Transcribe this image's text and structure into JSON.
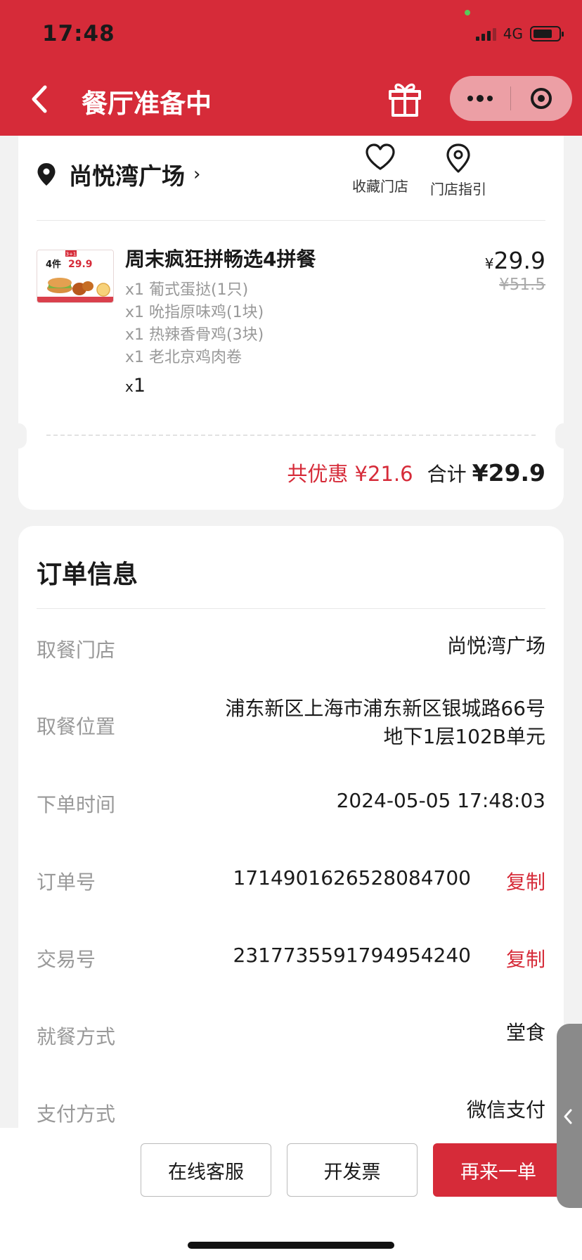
{
  "status_bar": {
    "time": "17:48",
    "network": "4G",
    "battery_level": 0.75,
    "signal_icon": "signal-bars-icon"
  },
  "nav": {
    "title": "餐厅准备中",
    "back_icon": "chevron-left-icon",
    "gift_icon": "gift-icon",
    "more_icon": "more-dots-icon",
    "close_icon": "target-close-icon",
    "brand_color": "#d62b39"
  },
  "store": {
    "name": "尚悦湾广场",
    "favorite_label": "收藏门店",
    "directions_label": "门店指引"
  },
  "product": {
    "title": "周末疯狂拼畅选4拼餐",
    "items": [
      "x1 葡式蛋挞(1只)",
      "x1 吮指原味鸡(1块)",
      "x1 热辣香骨鸡(3块)",
      "x1 老北京鸡肉卷"
    ],
    "qty_prefix": "x",
    "qty": "1",
    "price_symbol": "¥",
    "price": "29.9",
    "original_price": "¥51.5",
    "image": {
      "badge": "4件",
      "price": "29.9",
      "tag": "3+1"
    }
  },
  "totals": {
    "discount": "共优惠 ¥21.6",
    "label": "合计",
    "value": "¥29.9"
  },
  "order_info": {
    "heading": "订单信息",
    "rows": [
      {
        "label": "取餐门店",
        "value": "尚悦湾广场"
      },
      {
        "label": "取餐位置",
        "value_line1": "浦东新区上海市浦东新区银城路66号",
        "value_line2": "地下1层102B单元"
      },
      {
        "label": "下单时间",
        "value": "2024-05-05 17:48:03"
      },
      {
        "label": "订单号",
        "value": "1714901626528084700",
        "action": "复制"
      },
      {
        "label": "交易号",
        "value": "2317735591794954240",
        "action": "复制"
      },
      {
        "label": "就餐方式",
        "value": "堂食"
      },
      {
        "label": "支付方式",
        "value": "微信支付"
      }
    ]
  },
  "actions": {
    "service": "在线客服",
    "invoice": "开发票",
    "reorder": "再来一单"
  }
}
